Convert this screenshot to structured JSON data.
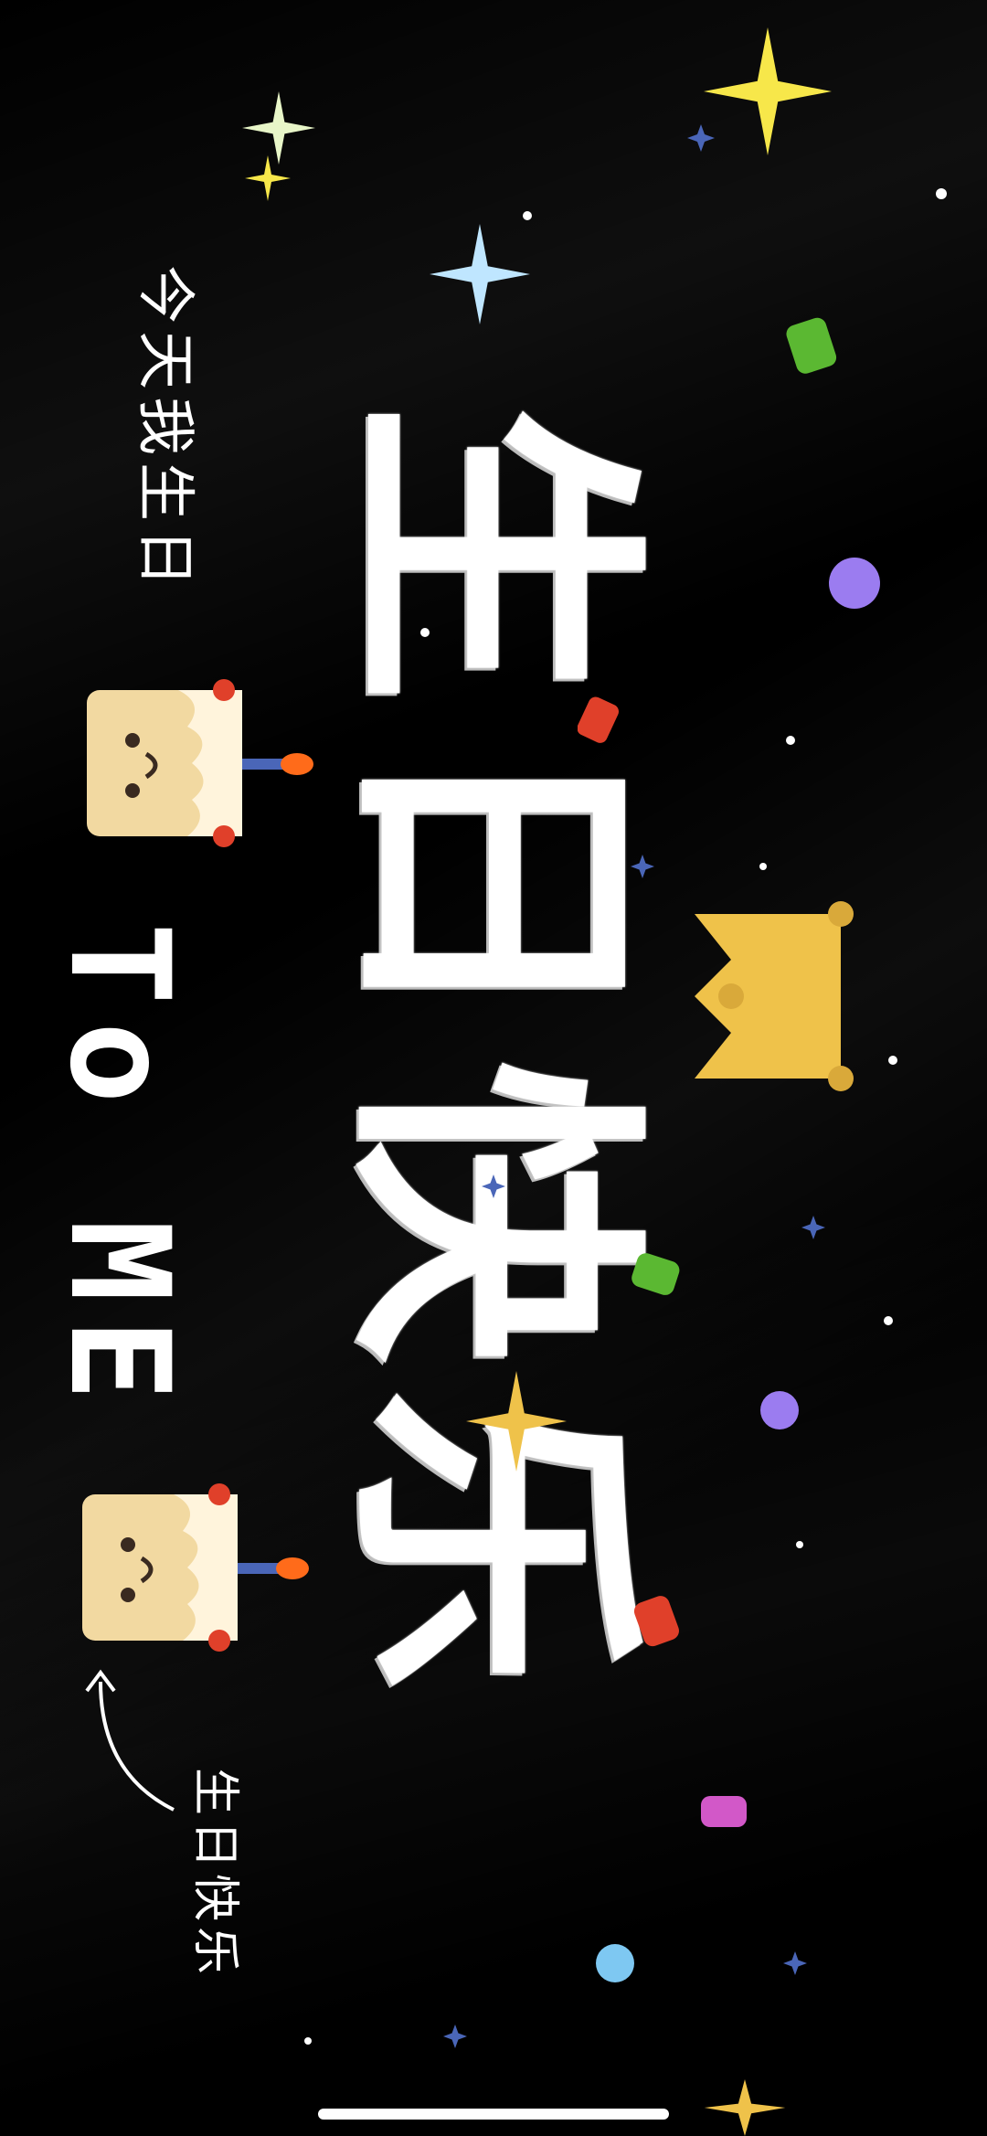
{
  "poster": {
    "main_title": "生日快乐",
    "today_note": "今天我生日",
    "to_me": "To ME",
    "signature": "生日快乐"
  },
  "colors": {
    "background": "#000000",
    "text": "#ffffff",
    "star_yellow": "#f7e74a",
    "star_pale": "#e8f6c8",
    "star_blue": "#bfe6ff",
    "crown": "#efc24a",
    "cake_body": "#f2d9a1",
    "candle_flame": "#ff6b1a",
    "purple_dot": "#9b7cf0",
    "blue_dot": "#7ec8f2",
    "green_confetti": "#5bb832",
    "red_confetti": "#e0402a",
    "pink_confetti": "#d258c8",
    "blue_cross": "#4a66b8"
  },
  "icons": [
    "sparkle-icon",
    "crown-icon",
    "cake-icon",
    "confetti-icon",
    "arrow-icon"
  ]
}
